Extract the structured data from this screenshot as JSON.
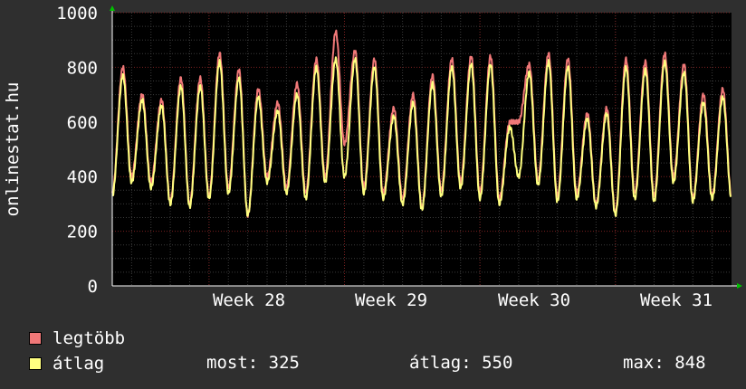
{
  "chart_data": {
    "type": "line",
    "ylabel": "onlinestat.hu",
    "ylim": [
      0,
      1000
    ],
    "y_ticks": [
      "0",
      "200",
      "400",
      "600",
      "800",
      "1000"
    ],
    "x_tick_labels": [
      "Week 28",
      "Week 29",
      "Week 30",
      "Week 31"
    ],
    "grid": true,
    "legend_placement": "bottom",
    "series": [
      {
        "name": "legtöbb",
        "color": "#f07878",
        "day_peaks": [
          800,
          700,
          680,
          760,
          760,
          850,
          790,
          720,
          670,
          740,
          830,
          930,
          860,
          830,
          650,
          700,
          770,
          830,
          840,
          840,
          600,
          810,
          850,
          830,
          630,
          650,
          830,
          820,
          850,
          810,
          700,
          720
        ],
        "day_troughs": [
          340,
          400,
          380,
          310,
          300,
          330,
          360,
          260,
          400,
          360,
          340,
          400,
          520,
          360,
          340,
          320,
          290,
          350,
          380,
          340,
          320,
          600,
          390,
          330,
          340,
          300,
          270,
          340,
          330,
          400,
          320,
          330
        ]
      },
      {
        "name": "átlag",
        "color": "#ffff80",
        "day_peaks": [
          770,
          680,
          660,
          730,
          730,
          820,
          760,
          690,
          640,
          700,
          800,
          830,
          830,
          800,
          620,
          670,
          740,
          800,
          810,
          810,
          580,
          780,
          820,
          800,
          610,
          630,
          800,
          790,
          820,
          780,
          670,
          690
        ],
        "day_troughs": [
          330,
          380,
          360,
          300,
          290,
          320,
          340,
          260,
          380,
          340,
          320,
          380,
          400,
          340,
          320,
          300,
          280,
          330,
          360,
          320,
          300,
          400,
          370,
          310,
          320,
          290,
          260,
          320,
          310,
          380,
          310,
          320
        ]
      }
    ]
  },
  "legend": {
    "max_label": "legtöbb",
    "avg_label": "átlag"
  },
  "stats": {
    "current": "most: 325",
    "average": "átlag: 550",
    "maximum": "max: 848"
  }
}
